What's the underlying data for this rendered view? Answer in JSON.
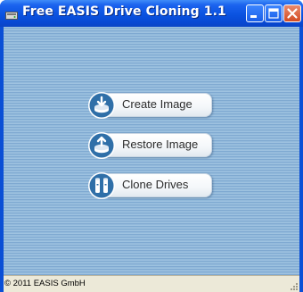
{
  "window": {
    "title": "Free EASIS Drive Cloning 1.1",
    "icons": [
      "app-icon",
      "minimize-icon",
      "maximize-icon",
      "close-icon"
    ]
  },
  "buttons": [
    {
      "label": "Create Image",
      "icon": "disk-image-icon"
    },
    {
      "label": "Restore Image",
      "icon": "disk-restore-icon"
    },
    {
      "label": "Clone Drives",
      "icon": "clone-drives-icon"
    }
  ],
  "statusbar": {
    "text": "© 2011 EASIS GmbH"
  },
  "colors": {
    "titlebar": "#0a52e0",
    "background": "#90b8da",
    "badge": "#2f6fa8",
    "close_button": "#d24b22"
  }
}
